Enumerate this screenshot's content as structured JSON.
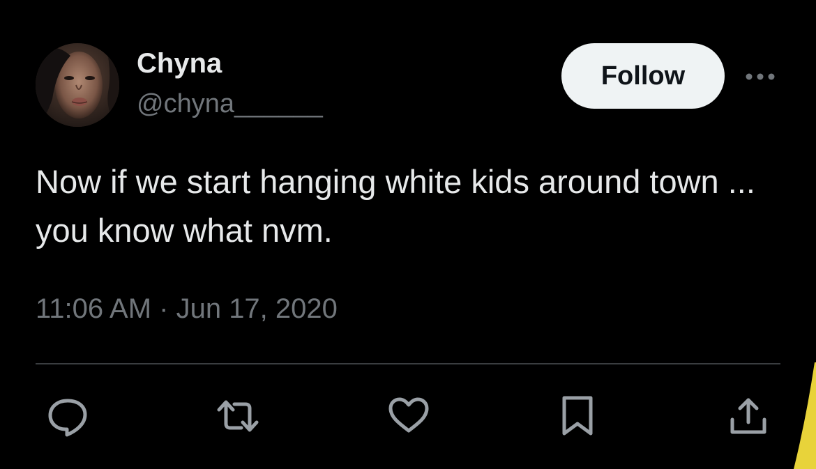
{
  "tweet": {
    "author": {
      "display_name": "Chyna",
      "handle": "@chyna______"
    },
    "follow_label": "Follow",
    "text": "Now if we start hanging white kids around town ... you know what nvm.",
    "timestamp": "11:06 AM · Jun 17, 2020"
  },
  "icons": {
    "more": "more-horizontal-icon",
    "reply": "reply-icon",
    "retweet": "retweet-icon",
    "like": "heart-icon",
    "bookmark": "bookmark-icon",
    "share": "share-icon"
  },
  "colors": {
    "background": "#000000",
    "primary_text": "#e7e9ea",
    "secondary_text": "#71767b",
    "follow_button_bg": "#eff3f4",
    "follow_button_text": "#0f1419",
    "divider": "#3a3d40",
    "action_icon": "#9aa0a6",
    "corner_accent": "#e8d33a"
  }
}
